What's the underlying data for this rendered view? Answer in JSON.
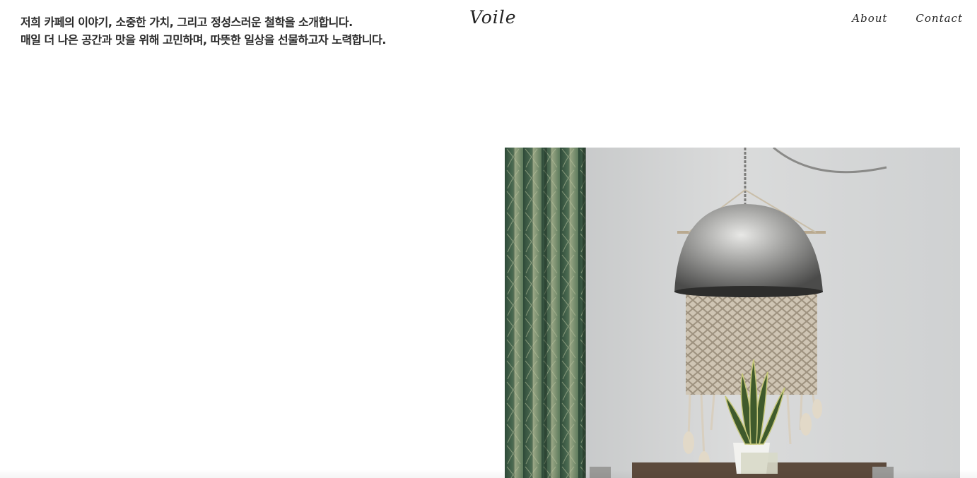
{
  "header": {
    "intro_line_1": "저희 카페의 이야기, 소중한 가치, 그리고 정성스러운 철학을 소개합니다.",
    "intro_line_2": "매일 더 나은 공간과 맛을 위해 고민하며, 따뜻한 일상을 선물하고자 노력합니다.",
    "logo": "Voile",
    "nav": {
      "about": "About",
      "contact": "Contact"
    }
  },
  "colors": {
    "background": "#ffffff",
    "text": "#222222"
  }
}
